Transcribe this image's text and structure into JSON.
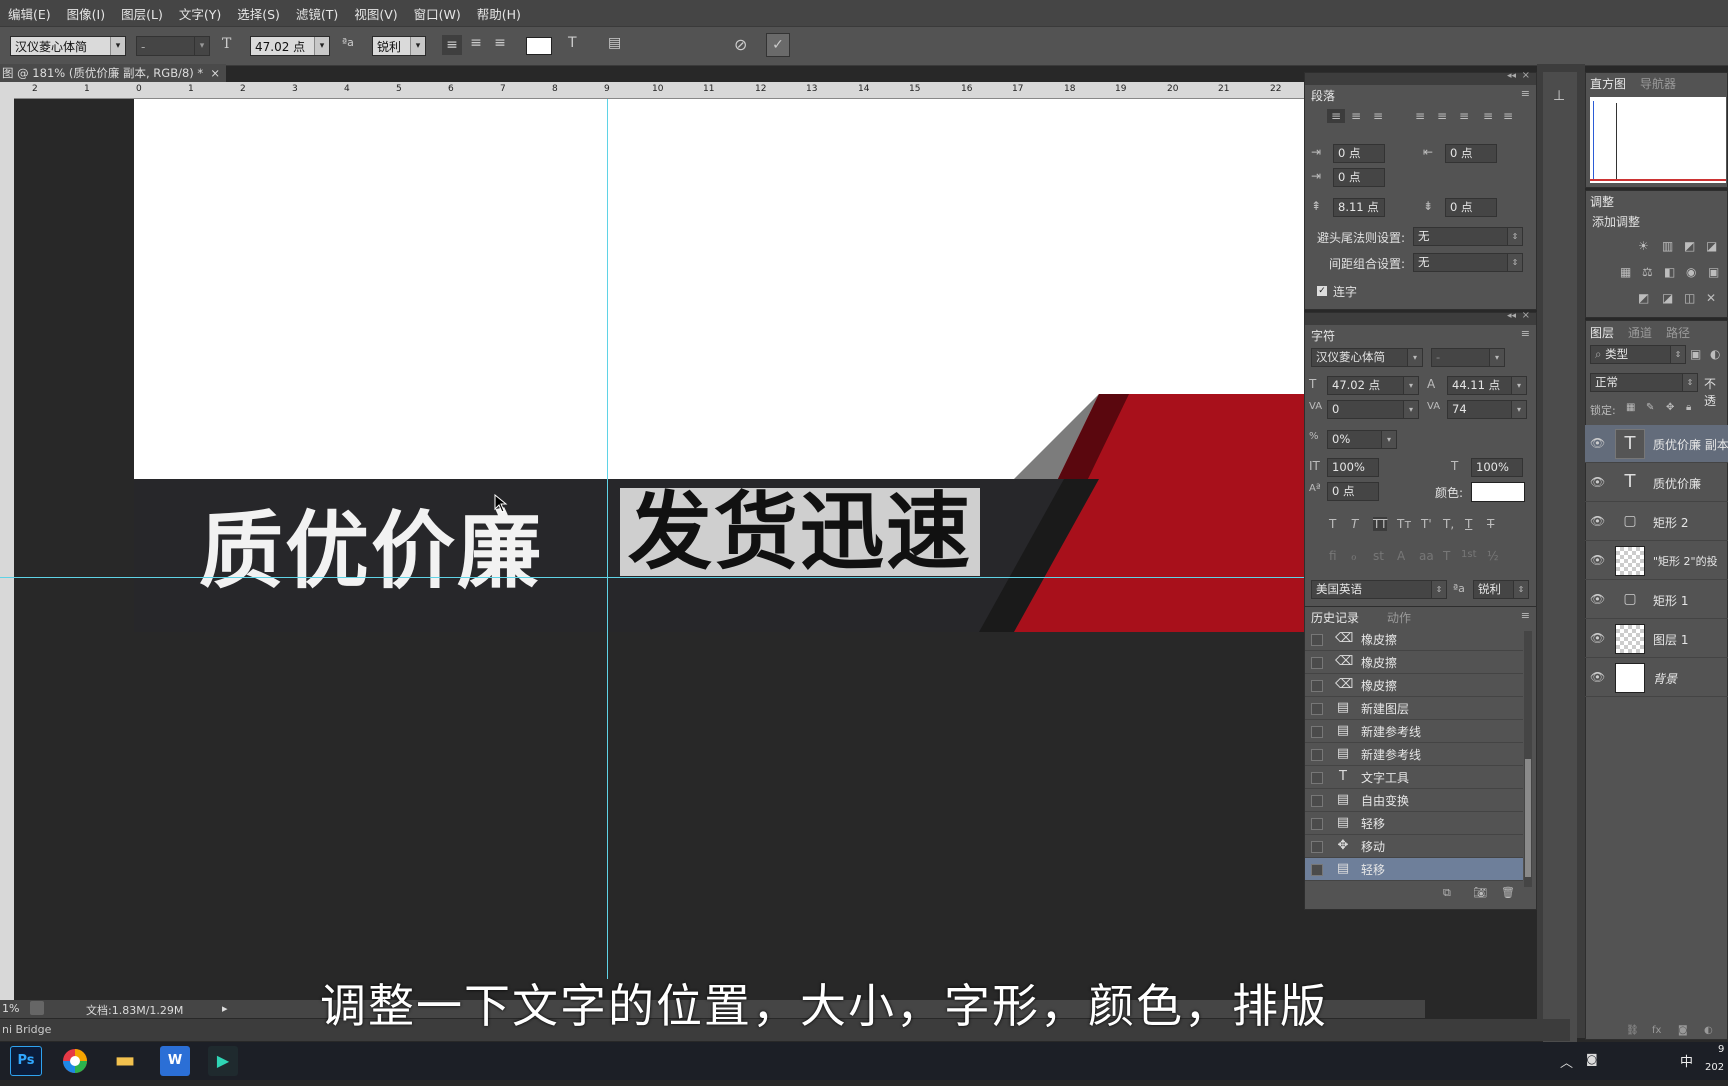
{
  "menu": [
    "编辑(E)",
    "图像(I)",
    "图层(L)",
    "文字(Y)",
    "选择(S)",
    "滤镜(T)",
    "视图(V)",
    "窗口(W)",
    "帮助(H)"
  ],
  "options": {
    "font_family": "汉仪菱心体简",
    "font_style": "-",
    "font_size": "47.02 点",
    "antialias": "锐利",
    "aa_icon": "ªa"
  },
  "document": {
    "tab_title": "图 @ 181% (质优价廉 副本, RGB/8) *",
    "ruler_ticks": [
      "2",
      "1",
      "0",
      "1",
      "2",
      "3",
      "4",
      "5",
      "6",
      "7",
      "8",
      "9",
      "10",
      "11",
      "12",
      "13",
      "14",
      "15",
      "16",
      "17",
      "18",
      "19",
      "20",
      "21",
      "22"
    ],
    "slogan_left": "质优价廉",
    "slogan_right": "发货迅速",
    "band_color": "#27272a",
    "accent_color": "#b0101c"
  },
  "paragraph_panel": {
    "title": "段落",
    "indent_left": "0 点",
    "indent_right": "0 点",
    "indent_first": "0 点",
    "space_before": "8.11 点",
    "space_after": "0 点",
    "kinsoku_label": "避头尾法则设置:",
    "kinsoku_value": "无",
    "mojikumi_label": "间距组合设置:",
    "mojikumi_value": "无",
    "hyphenate_label": "连字"
  },
  "character_panel": {
    "title": "字符",
    "font_family": "汉仪菱心体简",
    "font_style": "-",
    "size": "47.02 点",
    "leading": "44.11 点",
    "kerning": "0",
    "tracking": "74",
    "tsume": "0%",
    "vscale": "100%",
    "hscale": "100%",
    "baseline": "0 点",
    "color_label": "颜色:",
    "language": "美国英语",
    "antialias": "锐利",
    "aa_icon": "ªa",
    "style_buttons": [
      "T",
      "T",
      "TT",
      "Tт",
      "T'",
      "T,",
      "T",
      "T"
    ],
    "ot_buttons": [
      "fi",
      "ℴ",
      "st",
      "A",
      "aa",
      "T",
      "1st",
      "½"
    ]
  },
  "history_panel": {
    "tabs": [
      "历史记录",
      "动作"
    ],
    "items": [
      {
        "icon": "eraser-icon",
        "glyph": "⌫",
        "label": "橡皮擦"
      },
      {
        "icon": "eraser-icon",
        "glyph": "⌫",
        "label": "橡皮擦"
      },
      {
        "icon": "eraser-icon",
        "glyph": "⌫",
        "label": "橡皮擦"
      },
      {
        "icon": "document-icon",
        "glyph": "▤",
        "label": "新建图层"
      },
      {
        "icon": "document-icon",
        "glyph": "▤",
        "label": "新建参考线"
      },
      {
        "icon": "document-icon",
        "glyph": "▤",
        "label": "新建参考线"
      },
      {
        "icon": "type-tool-icon",
        "glyph": "T",
        "label": "文字工具"
      },
      {
        "icon": "document-icon",
        "glyph": "▤",
        "label": "自由变换"
      },
      {
        "icon": "document-icon",
        "glyph": "▤",
        "label": "轻移"
      },
      {
        "icon": "move-tool-icon",
        "glyph": "✥",
        "label": "移动"
      },
      {
        "icon": "document-icon",
        "glyph": "▤",
        "label": "轻移"
      }
    ]
  },
  "right_top": {
    "tabs": [
      "直方图",
      "导航器"
    ],
    "adjust_title": "调整",
    "adjust_add": "添加调整"
  },
  "layers_panel": {
    "tabs": [
      "图层",
      "通道",
      "路径"
    ],
    "filter_kind": "类型",
    "blend_mode": "正常",
    "opacity_label": "不透",
    "lock_label": "锁定:",
    "layers": [
      {
        "name": "质优价廉 副本",
        "thumb": "text",
        "glyph": "T"
      },
      {
        "name": "质优价廉",
        "thumb": "text-plain",
        "glyph": "T"
      },
      {
        "name": "矩形 2",
        "thumb": "shape",
        "glyph": "▢"
      },
      {
        "name": "\"矩形 2\"的投",
        "thumb": "checker",
        "glyph": ""
      },
      {
        "name": "矩形 1",
        "thumb": "shape",
        "glyph": "▢"
      },
      {
        "name": "图层 1",
        "thumb": "checker",
        "glyph": ""
      },
      {
        "name": "背景",
        "thumb": "white",
        "glyph": ""
      }
    ]
  },
  "status": {
    "zoom": "1%",
    "doc_size": "文档:1.83M/1.29M",
    "bridge": "ni Bridge"
  },
  "subtitle": "调整一下文字的位置，大小，字形，颜色，排版",
  "taskbar": {
    "apps": [
      "Ps",
      "",
      "",
      "W",
      ""
    ],
    "ime": "中",
    "clock_top": "9",
    "clock_bottom": "202"
  }
}
